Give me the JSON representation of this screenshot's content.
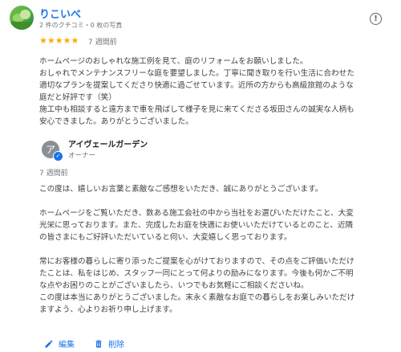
{
  "review": {
    "reviewer_name": "りこいべ",
    "reviewer_meta": "2 件のクチコミ・0 枚の写真",
    "stars": "★★★★★",
    "rating": 5,
    "time": "7 週間前",
    "text": "ホームページのおしゃれな施工例を見て、庭のリフォームをお願いしました。\nおしゃれでメンテナンスフリーな庭を要望しました。丁寧に聞き取りを行い生活に合わせた\n適切なプランを提案してくださり快適に過ごせています。近所の方からも高級旅館のような\n庭だと好評です（笑）\n施工中も相談すると遠方まで車を飛ばして様子を見に来てくださる坂田さんの誠実な人柄も\n安心できました。ありがとうございました。"
  },
  "reply": {
    "owner_initial": "ア",
    "owner_name": "アイヴェールガーデン",
    "owner_role": "オーナー",
    "time": "7 週間前",
    "text": "この度は、嬉しいお言葉と素敵なご感想をいただき、誠にありがとうございます。\n\nホームページをご覧いただき、数ある施工会社の中から当社をお選びいただけたこと、大変\n光栄に思っております。また、完成したお庭を快適にお使いいただけているとのこと、近隣\nの皆さまにもご好評いただいていると伺い、大変嬉しく思っております。\n\n常にお客様の暮らしに寄り添ったご提案を心がけておりますので、その点をご評価いただけ\nたことは、私をはじめ、スタッフ一同にとって何よりの励みになります。今後も何かご不明\nな点やお困りのことがございましたら、いつでもお気軽にご相談くださいね。\nこの度は本当にありがとうございました。末永く素敵なお庭での暮らしをお楽しみいただけ\nますよう、心よりお祈り申し上げます。"
  },
  "actions": {
    "edit_label": "編集",
    "delete_label": "削除"
  },
  "icons": {
    "info": "info-icon",
    "edit": "pencil-icon",
    "delete": "trash-icon",
    "verified": "check-badge-icon"
  },
  "colors": {
    "accent": "#1a73e8",
    "star": "#f9ab00"
  }
}
